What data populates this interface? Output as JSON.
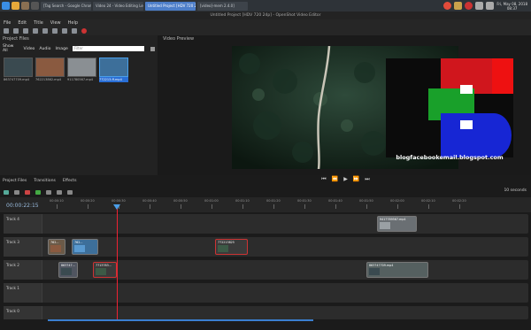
{
  "taskbar": {
    "tabs": [
      {
        "label": "[Tag Search - Google Chrom..."
      },
      {
        "label": "Video 24 - Video Editing Lear..."
      },
      {
        "label": "Untitled Project [HDV 720 24..."
      },
      {
        "label": "[video]-mem 2.4.0]"
      }
    ],
    "active_tab_index": 2,
    "clock_line1": "Fri, May 08, 2018",
    "clock_line2": "08:37"
  },
  "window": {
    "title": "Untitled Project [HDV 720 24p] - OpenShot Video Editor"
  },
  "menu": [
    "File",
    "Edit",
    "Title",
    "View",
    "Help"
  ],
  "project_files": {
    "header": "Project Files",
    "tabs": [
      "Show All",
      "Video",
      "Audio",
      "Image"
    ],
    "filter_placeholder": "Filter",
    "files": [
      {
        "name": "863747709.mp4",
        "color": "#3a4a50"
      },
      {
        "name": "762213862.mp4",
        "color": "#8a5a40"
      },
      {
        "name": "911780567.mp4",
        "color": "#8a8f93"
      },
      {
        "name": "772213.ff.mp4",
        "color": "#3d6f9a",
        "selected": true
      }
    ]
  },
  "video_preview": {
    "header": "Video Preview"
  },
  "watermark": {
    "text": "blogfacebookemail.blogspot.com"
  },
  "dock_tabs": [
    "Project Files",
    "Transitions",
    "Effects"
  ],
  "timeline": {
    "timecode": "00:00:22:15",
    "zoom_label": "10 seconds",
    "tick_labels": [
      "00:00:10",
      "00:00:20",
      "00:00:30",
      "00:00:40",
      "00:00:50",
      "00:01:00",
      "00:01:10",
      "00:01:20",
      "00:01:30",
      "00:01:40",
      "00:01:50",
      "00:02:00",
      "00:02:10",
      "00:02:20"
    ],
    "tracks": [
      {
        "name": "Track 4",
        "clips": [
          {
            "label": "9417789567.mp4",
            "color": "#8a8f93"
          }
        ]
      },
      {
        "name": "Track 3",
        "clips": [
          {
            "label": "762...",
            "color": "#6b5a48"
          },
          {
            "label": "762...",
            "color": "#3d6f9a"
          },
          {
            "label": "772213825",
            "color": "#7a2020"
          }
        ]
      },
      {
        "name": "Track 2",
        "clips": [
          {
            "label": "863747...",
            "color": "#556"
          },
          {
            "label": "7713783...",
            "color": "#7a2020"
          },
          {
            "label": "863747709.mp4",
            "color": "#566"
          }
        ]
      },
      {
        "name": "Track 1",
        "clips": []
      },
      {
        "name": "Track 0",
        "clips": []
      }
    ]
  }
}
